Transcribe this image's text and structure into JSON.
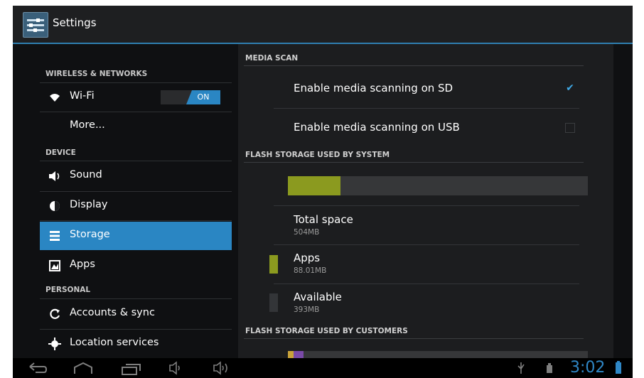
{
  "action_bar": {
    "title": "Settings"
  },
  "left_panel": {
    "headers": {
      "wireless": "WIRELESS & NETWORKS",
      "device": "DEVICE",
      "personal": "PERSONAL"
    },
    "items": [
      {
        "label": "Wi-Fi",
        "icon": "wifi-icon",
        "toggle": "ON"
      },
      {
        "label": "More..."
      },
      {
        "label": "Sound",
        "icon": "sound-icon"
      },
      {
        "label": "Display",
        "icon": "display-icon"
      },
      {
        "label": "Storage",
        "icon": "storage-icon",
        "selected": true
      },
      {
        "label": "Apps",
        "icon": "apps-icon"
      },
      {
        "label": "Accounts & sync",
        "icon": "sync-icon"
      },
      {
        "label": "Location services",
        "icon": "location-icon"
      }
    ]
  },
  "right_panel": {
    "media_scan": {
      "header": "MEDIA SCAN",
      "sd": {
        "label": "Enable media scanning on SD",
        "checked": true
      },
      "usb": {
        "label": "Enable media scanning on USB",
        "checked": false
      }
    },
    "system_storage": {
      "header": "FLASH STORAGE USED BY SYSTEM",
      "used_fraction": 0.175,
      "total": {
        "label": "Total space",
        "value": "504MB"
      },
      "apps": {
        "label": "Apps",
        "value": "88.01MB",
        "color": "#8b9a1f"
      },
      "available": {
        "label": "Available",
        "value": "393MB",
        "color": "#333538"
      }
    },
    "customer_storage": {
      "header": "FLASH STORAGE USED BY CUSTOMERS"
    }
  },
  "status_bar": {
    "time": "3:02"
  },
  "colors": {
    "accent": "#2a86c3",
    "apps_bar": "#8b9a1f",
    "clock": "#2f87c6"
  }
}
